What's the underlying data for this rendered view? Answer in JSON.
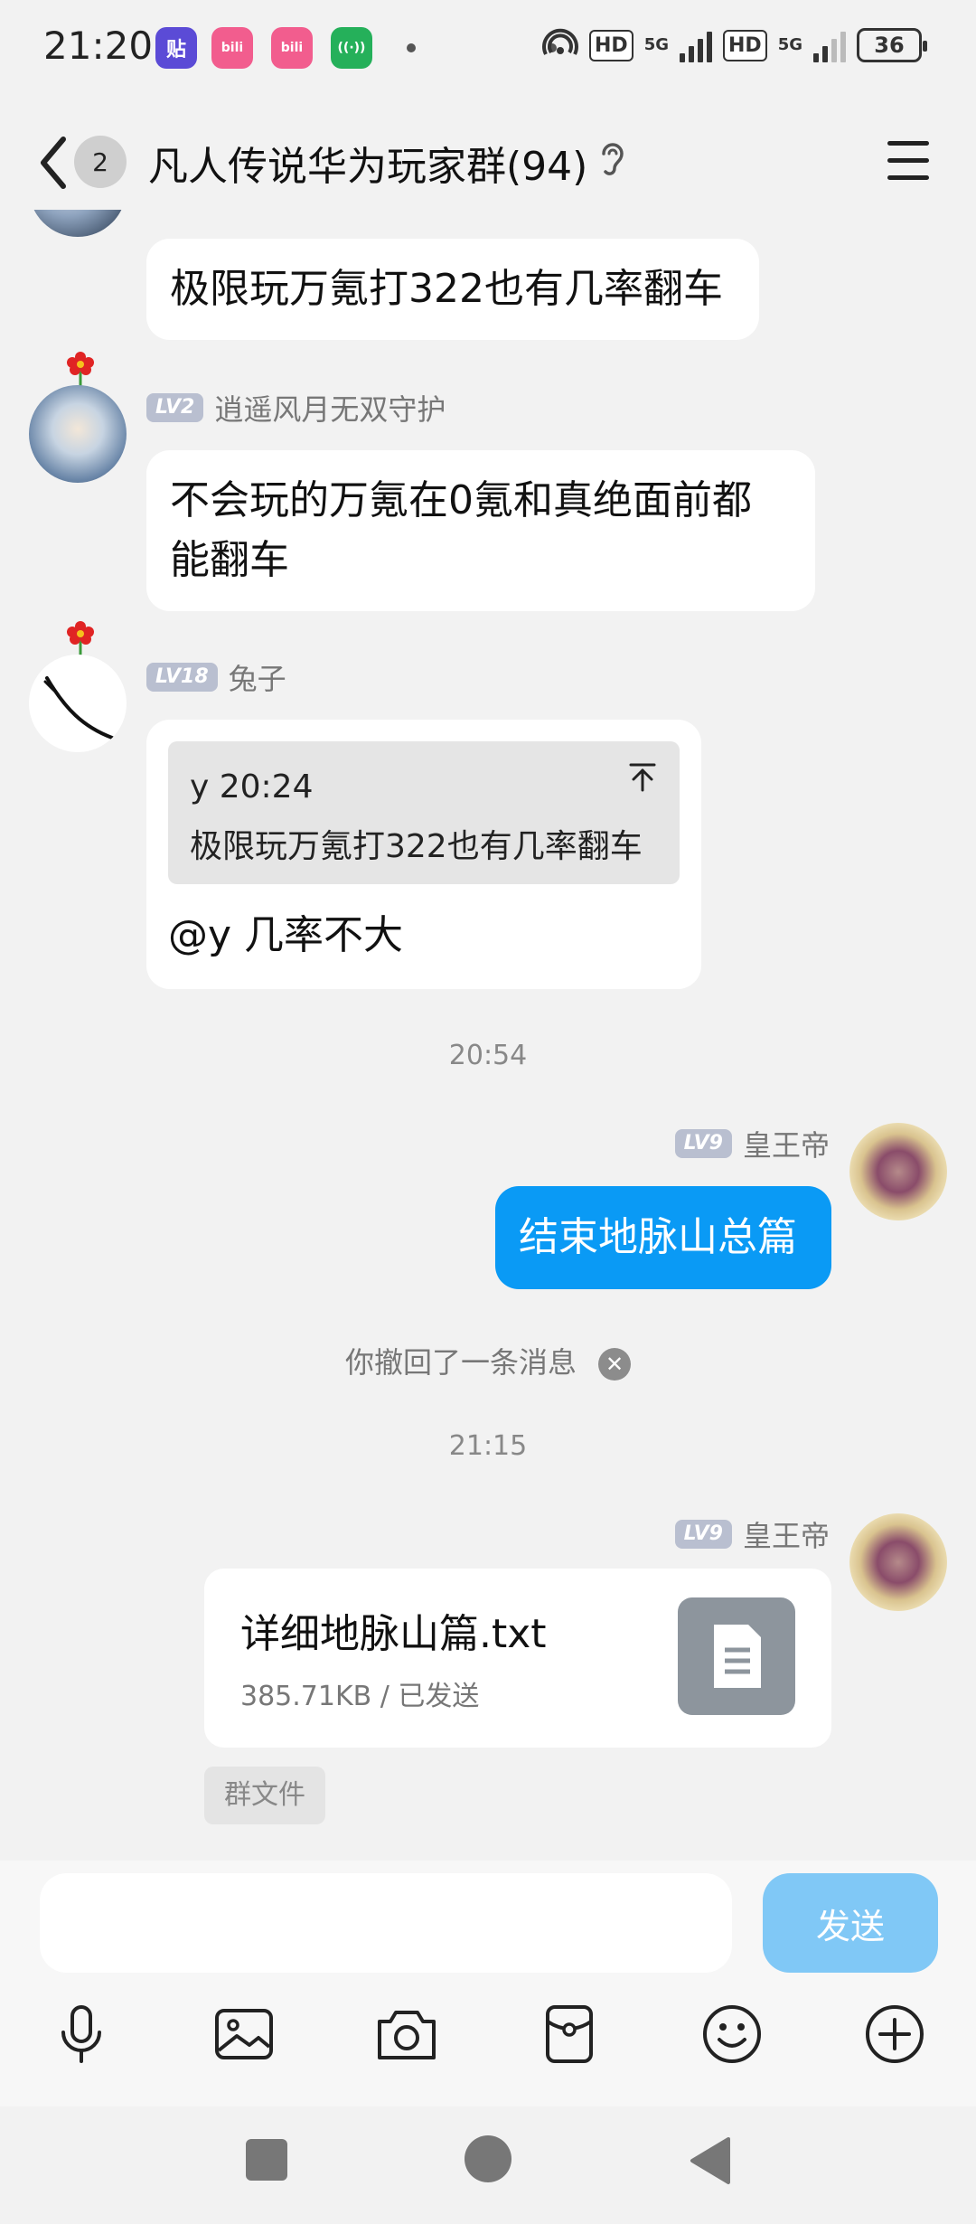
{
  "status_bar": {
    "time": "21:20",
    "network1": "5G",
    "network2": "5G",
    "hd1": "HD",
    "hd2": "HD",
    "battery": "36",
    "app_icons": [
      {
        "name": "tieba-icon",
        "glyph": "贴",
        "color": "#5b4bd6"
      },
      {
        "name": "bilibili-icon",
        "glyph": "bili",
        "color": "#f25d8e"
      },
      {
        "name": "bilibili-icon-2",
        "glyph": "bili",
        "color": "#f25d8e"
      },
      {
        "name": "wifi-app-icon",
        "glyph": "((·))",
        "color": "#25b05a"
      }
    ]
  },
  "header": {
    "unread_count": "2",
    "title": "凡人传说华为玩家群(94)"
  },
  "messages": [
    {
      "type": "incoming",
      "text": "极限玩万氪打322也有几率翻车"
    },
    {
      "type": "incoming",
      "level": "LV2",
      "sender": "逍遥风月无双守护",
      "text_line1": "不会玩的万氪在0氪和真绝面前都",
      "text_line2": "能翻车"
    },
    {
      "type": "incoming",
      "level": "LV18",
      "sender": "兔子",
      "quote_header": "y 20:24",
      "quote_text": "极限玩万氪打322也有几率翻车",
      "text": "@y 几率不大"
    },
    {
      "type": "time",
      "text": "20:54"
    },
    {
      "type": "outgoing",
      "level": "LV9",
      "sender": "皇王帝",
      "text": "结束地脉山总篇"
    },
    {
      "type": "system",
      "text": "你撤回了一条消息"
    },
    {
      "type": "time",
      "text": "21:15"
    },
    {
      "type": "outgoing_file",
      "level": "LV9",
      "sender": "皇王帝",
      "file_name": "详细地脉山篇.txt",
      "file_meta": "385.71KB / 已发送",
      "tag": "群文件"
    }
  ],
  "input": {
    "value": "",
    "send_label": "发送"
  },
  "toolbar": [
    "microphone-icon",
    "image-icon",
    "camera-icon",
    "red-packet-icon",
    "emoji-icon",
    "plus-icon"
  ],
  "colors": {
    "accent": "#0a9af5",
    "send_disabled": "#80c8f6",
    "background": "#f2f2f2"
  }
}
